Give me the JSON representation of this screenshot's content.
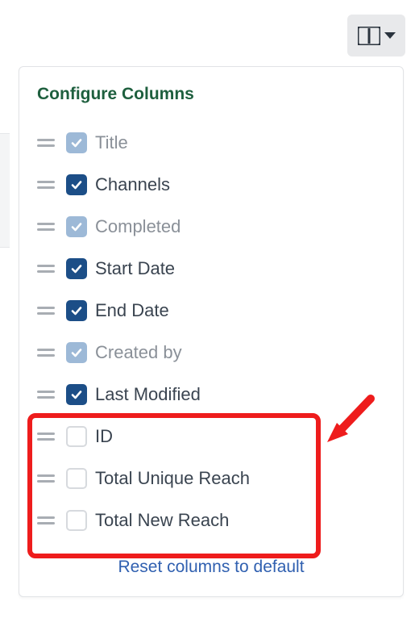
{
  "panel": {
    "title": "Configure Columns",
    "reset_label": "Reset columns to default"
  },
  "columns": [
    {
      "label": "Title",
      "state": "checked-muted"
    },
    {
      "label": "Channels",
      "state": "checked"
    },
    {
      "label": "Completed",
      "state": "checked-muted"
    },
    {
      "label": "Start Date",
      "state": "checked"
    },
    {
      "label": "End Date",
      "state": "checked"
    },
    {
      "label": "Created by",
      "state": "checked-muted"
    },
    {
      "label": "Last Modified",
      "state": "checked"
    },
    {
      "label": "ID",
      "state": "unchecked"
    },
    {
      "label": "Total Unique Reach",
      "state": "unchecked"
    },
    {
      "label": "Total New Reach",
      "state": "unchecked"
    }
  ],
  "colors": {
    "accent_green": "#1e5f3e",
    "checkbox_checked": "#1c4e87",
    "checkbox_muted": "#9db9d7",
    "highlight_red": "#ee1c1c",
    "link_blue": "#3060b0"
  },
  "annotation": {
    "highlighted_indices": [
      7,
      8,
      9
    ]
  }
}
